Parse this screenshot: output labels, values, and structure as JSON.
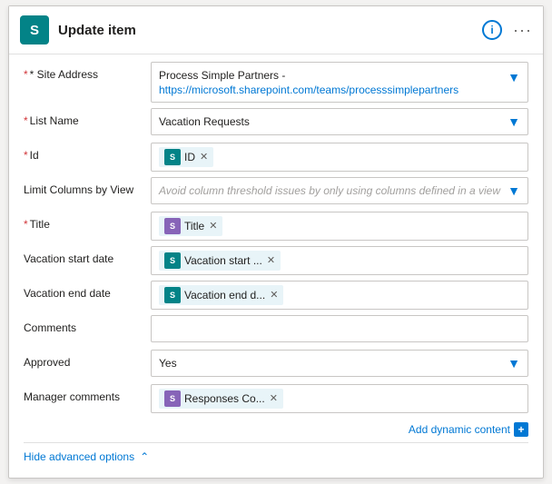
{
  "header": {
    "icon_letter": "S",
    "title": "Update item",
    "info_label": "i",
    "more_label": "···"
  },
  "fields": {
    "site_address": {
      "label": "* Site Address",
      "line1": "Process Simple Partners -",
      "line2": "https://microsoft.sharepoint.com/teams/processsimplepartners",
      "required": true
    },
    "list_name": {
      "label": "* List Name",
      "value": "Vacation Requests",
      "required": true
    },
    "id": {
      "label": "* Id",
      "chip_label": "ID",
      "required": true
    },
    "limit_columns": {
      "label": "Limit Columns by View",
      "placeholder": "Avoid column threshold issues by only using columns defined in a view",
      "required": false
    },
    "title": {
      "label": "* Title",
      "chip_label": "Title",
      "required": true
    },
    "vacation_start": {
      "label": "Vacation start date",
      "chip_label": "Vacation start ...",
      "required": false
    },
    "vacation_end": {
      "label": "Vacation end date",
      "chip_label": "Vacation end d...",
      "required": false
    },
    "comments": {
      "label": "Comments",
      "required": false
    },
    "approved": {
      "label": "Approved",
      "value": "Yes",
      "required": false
    },
    "manager_comments": {
      "label": "Manager comments",
      "chip_label": "Responses Co...",
      "required": false
    }
  },
  "add_dynamic_content": "Add dynamic content",
  "hide_advanced": "Hide advanced options"
}
